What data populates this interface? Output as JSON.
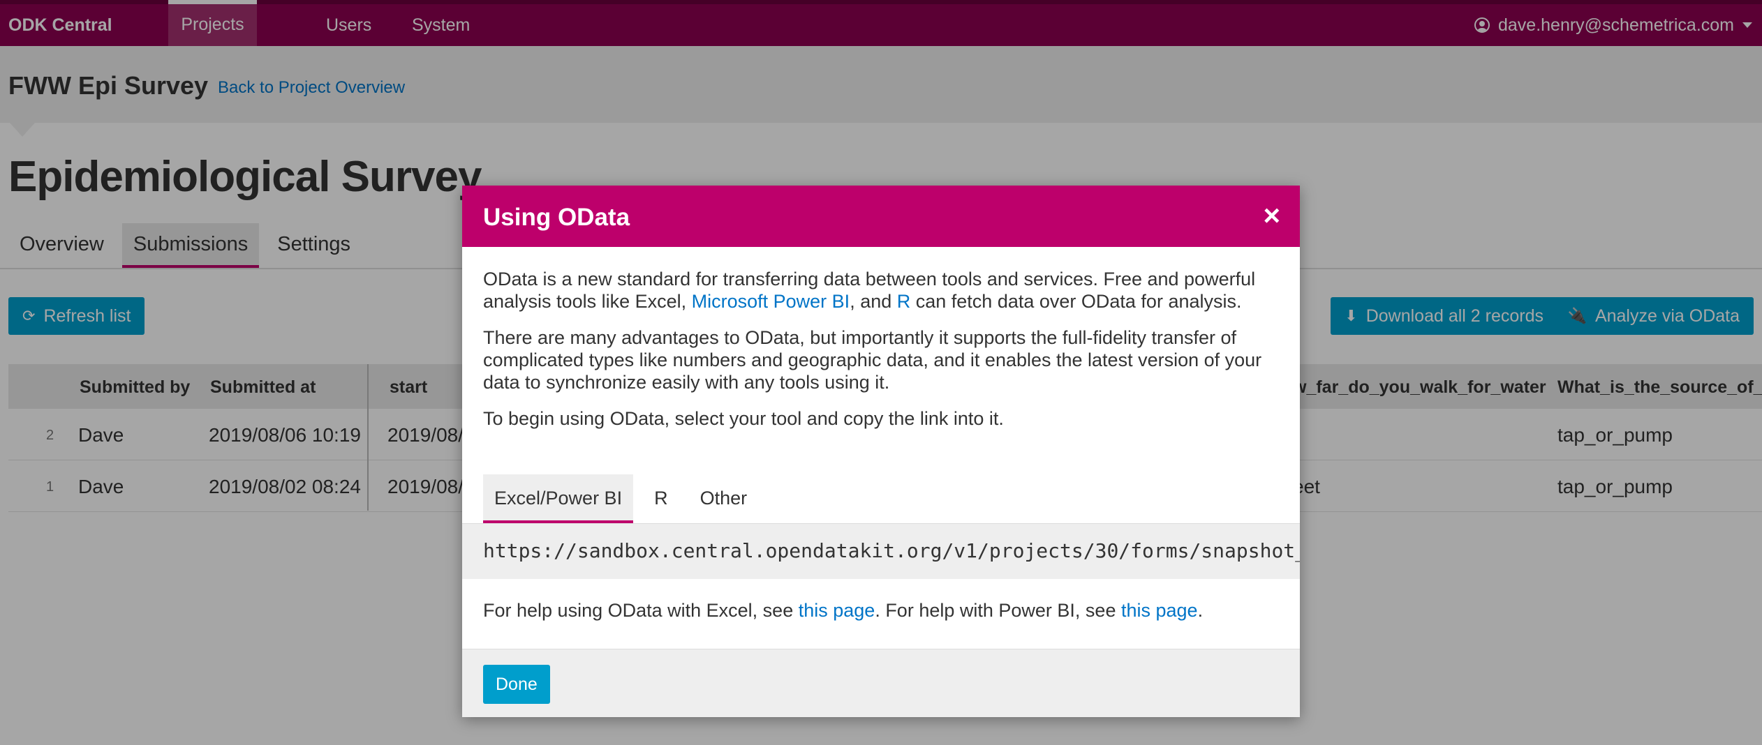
{
  "navbar": {
    "brand": "ODK Central",
    "items": [
      {
        "label": "Projects"
      },
      {
        "label": "Users"
      },
      {
        "label": "System"
      }
    ],
    "user": "dave.henry@schemetrica.com"
  },
  "project": {
    "name": "FWW Epi Survey",
    "back_link": "Back to Project Overview"
  },
  "form": {
    "title": "Epidemiological Survey",
    "tabs": [
      {
        "label": "Overview"
      },
      {
        "label": "Submissions"
      },
      {
        "label": "Settings"
      }
    ]
  },
  "toolbar": {
    "refresh": "Refresh list",
    "download": "Download all 2 records",
    "analyze": "Analyze via OData"
  },
  "table": {
    "headers": [
      "Submitted by",
      "Submitted at",
      "start",
      "w_far_do_you_walk_for_water",
      "What_is_the_source_of_w"
    ],
    "rows": [
      {
        "num": "2",
        "submitted_by": "Dave",
        "submitted_at": "2019/08/06 10:19",
        "start": "2019/08/",
        "walk": "",
        "source": "tap_or_pump"
      },
      {
        "num": "1",
        "submitted_by": "Dave",
        "submitted_at": "2019/08/02 08:24",
        "start": "2019/08/",
        "walk": "eet",
        "source": "tap_or_pump"
      }
    ]
  },
  "modal": {
    "title": "Using OData",
    "close": "×",
    "para1": {
      "text_a": "OData is a new standard for transferring data between tools and services. Free and powerful analysis tools like Excel, ",
      "link_powerbi": "Microsoft Power BI",
      "text_b": ", and ",
      "link_r": "R",
      "text_c": " can fetch data over OData for analysis."
    },
    "para2": "There are many advantages to OData, but importantly it supports the full-fidelity transfer of complicated types like numbers and geographic data, and it enables the latest version of your data to synchronize easily with any tools using it.",
    "para3": "To begin using OData, select your tool and copy the link into it.",
    "tool_tabs": [
      {
        "label": "Excel/Power BI"
      },
      {
        "label": "R"
      },
      {
        "label": "Other"
      }
    ],
    "url": "https://sandbox.central.opendatakit.org/v1/projects/30/forms/snapshot_",
    "help": {
      "text_a": "For help using OData with Excel, see ",
      "link_a": "this page",
      "text_b": ". For help with Power BI, see ",
      "link_b": "this page",
      "text_c": "."
    },
    "done": "Done"
  }
}
